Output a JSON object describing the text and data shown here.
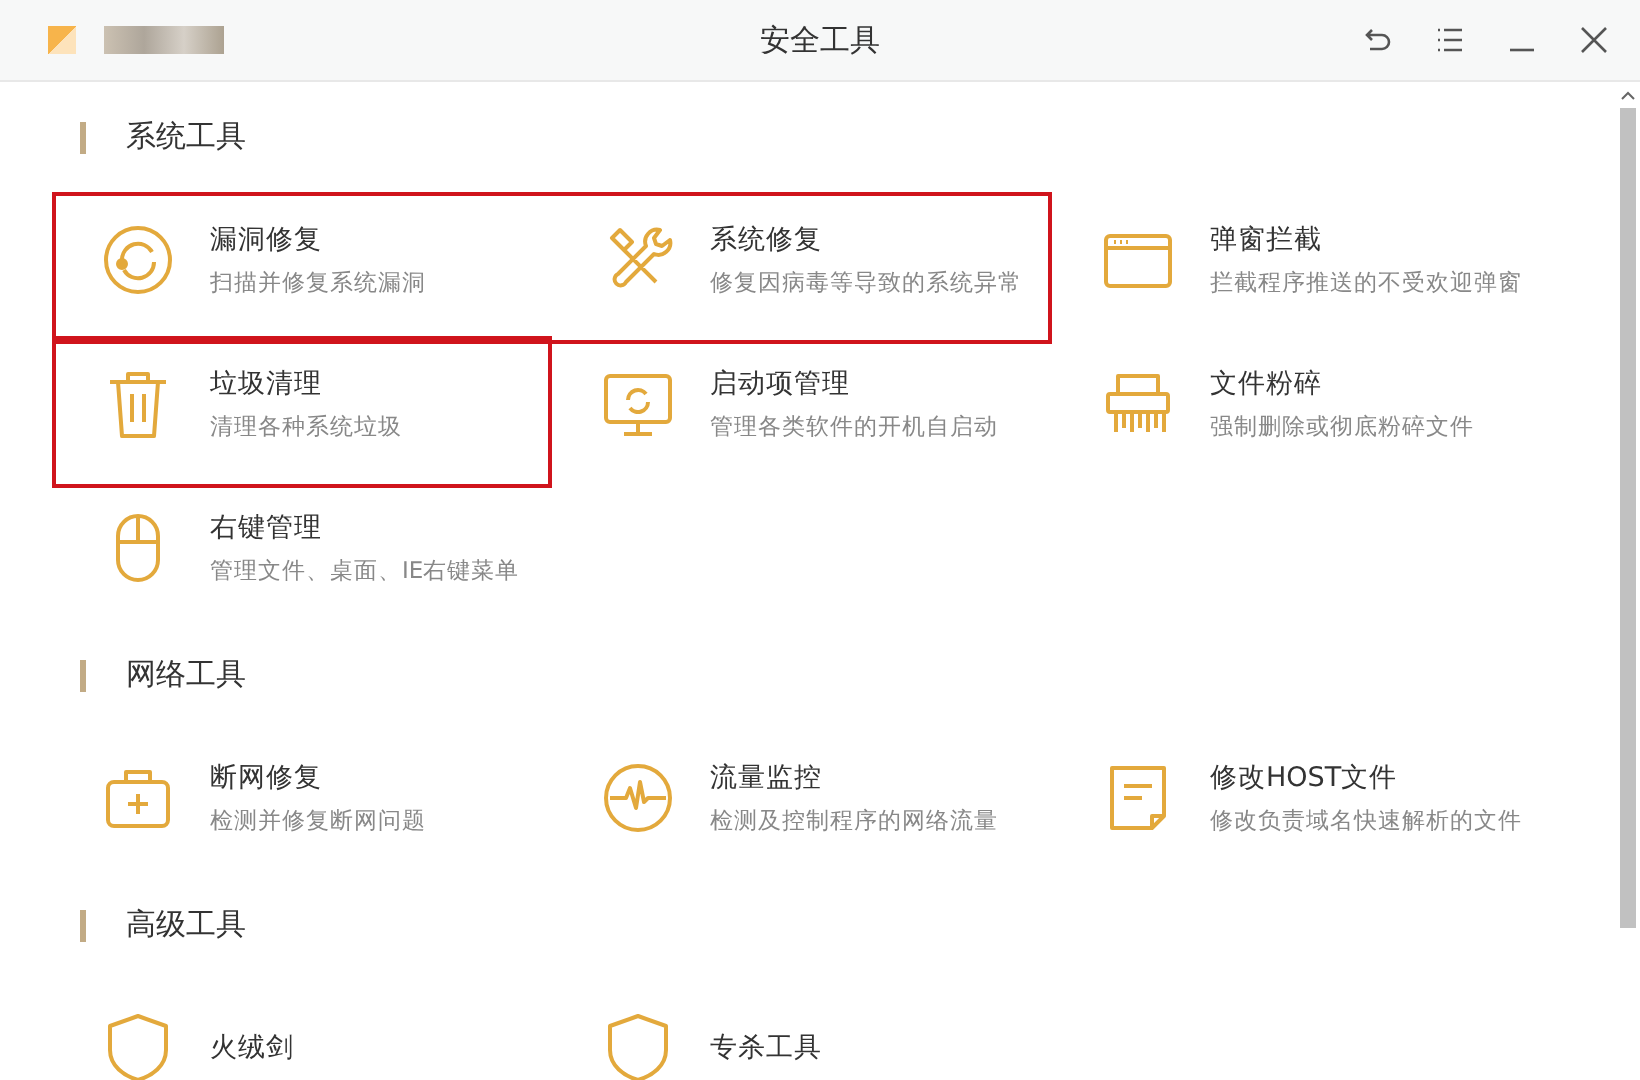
{
  "window": {
    "title": "安全工具"
  },
  "sections": [
    {
      "title": "系统工具",
      "items": [
        {
          "kind": "repair",
          "title": "漏洞修复",
          "desc": "扫描并修复系统漏洞",
          "highlighted": true
        },
        {
          "kind": "tools",
          "title": "系统修复",
          "desc": "修复因病毒等导致的系统异常",
          "highlighted": true
        },
        {
          "kind": "popup",
          "title": "弹窗拦截",
          "desc": "拦截程序推送的不受欢迎弹窗",
          "highlighted": false
        },
        {
          "kind": "trash",
          "title": "垃圾清理",
          "desc": "清理各种系统垃圾",
          "highlighted": true
        },
        {
          "kind": "monitor",
          "title": "启动项管理",
          "desc": "管理各类软件的开机自启动",
          "highlighted": false
        },
        {
          "kind": "shredder",
          "title": "文件粉碎",
          "desc": "强制删除或彻底粉碎文件",
          "highlighted": false
        },
        {
          "kind": "mouse",
          "title": "右键管理",
          "desc": "管理文件、桌面、IE右键菜单",
          "highlighted": false
        }
      ]
    },
    {
      "title": "网络工具",
      "items": [
        {
          "kind": "medkit",
          "title": "断网修复",
          "desc": "检测并修复断网问题",
          "highlighted": false
        },
        {
          "kind": "pulse",
          "title": "流量监控",
          "desc": "检测及控制程序的网络流量",
          "highlighted": false
        },
        {
          "kind": "note",
          "title": "修改HOST文件",
          "desc": "修改负责域名快速解析的文件",
          "highlighted": false
        }
      ]
    },
    {
      "title": "高级工具",
      "items": [
        {
          "kind": "shield",
          "title": "火绒剑",
          "highlighted": false
        },
        {
          "kind": "shield",
          "title": "专杀工具",
          "highlighted": false
        }
      ]
    }
  ]
}
